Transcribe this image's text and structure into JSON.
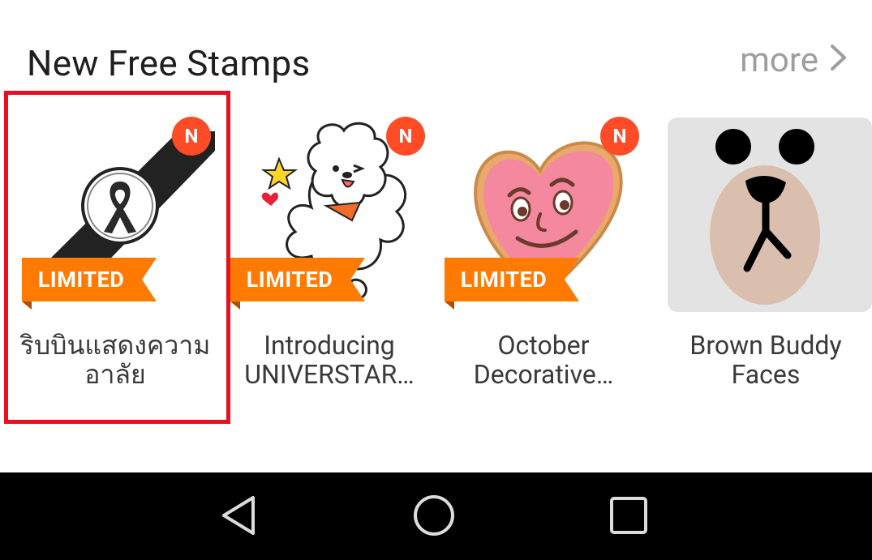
{
  "section": {
    "title": "New Free Stamps",
    "more_label": "more"
  },
  "badge_new": "N",
  "badge_limited": "LIMITED",
  "stamps": [
    {
      "title": "ริบบินแสดงความ\nอาลัย",
      "icon": "black-ribbon-band-icon",
      "new": true,
      "limited": true,
      "selected": true
    },
    {
      "title": "Introducing\nUNIVERSTAR…",
      "icon": "white-fluffy-character-icon",
      "new": true,
      "limited": true,
      "selected": false
    },
    {
      "title": "October\nDecorative…",
      "icon": "pink-heart-face-icon",
      "new": true,
      "limited": true,
      "selected": false
    },
    {
      "title": "Brown Buddy\nFaces",
      "icon": "brown-bear-face-icon",
      "new": false,
      "limited": false,
      "selected": false
    }
  ],
  "colors": {
    "accent_orange": "#ff7a00",
    "badge_red": "#ff4b26",
    "selection_red": "#e8101e",
    "navbar": "#000000"
  },
  "navbar": {
    "back_icon": "back-triangle-icon",
    "home_icon": "home-circle-icon",
    "recents_icon": "recents-square-icon"
  }
}
